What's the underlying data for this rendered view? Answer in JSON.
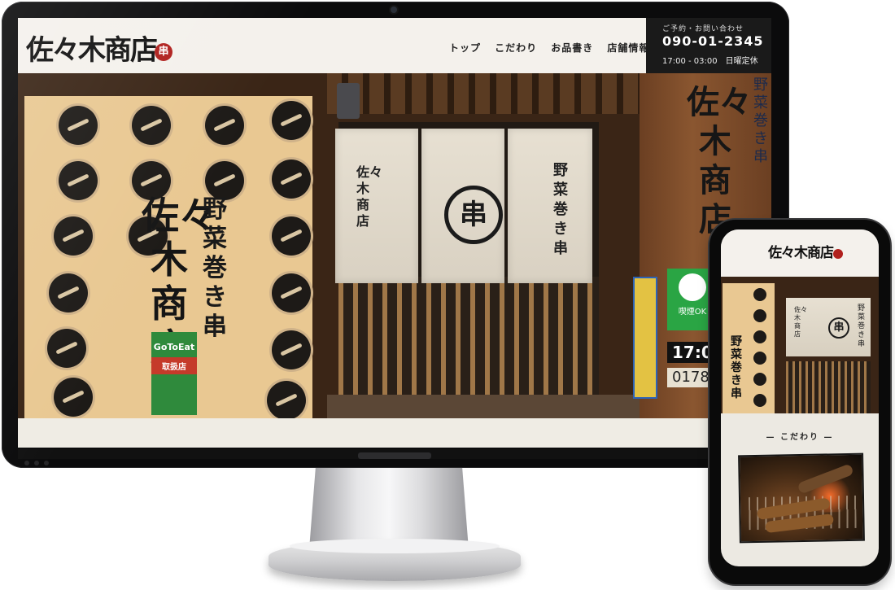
{
  "desktop": {
    "logo": {
      "text": "佐々木商店",
      "seal": "串"
    },
    "nav": [
      "トップ",
      "こだわり",
      "お品書き",
      "店舗情報"
    ],
    "contact": {
      "label": "ご予約・お問い合わせ",
      "phone": "090-01-2345",
      "hours": "17:00 - 03:00　日曜定休"
    },
    "hero": {
      "banner_vertical": "佐々木商店",
      "banner_vertical_small": "野菜巻き串",
      "gotoeat": "GoToEat",
      "gotoeat_sub": "取扱店",
      "noren_left": "佐々木商店",
      "noren_mark": "串",
      "noren_right": "野菜巻き串",
      "sign_right": "佐々木商店",
      "sign_right_small": "野菜巻き串",
      "smoking_sign": "喫煙OK",
      "time_sign": "17:0",
      "number_sign": "0178"
    }
  },
  "mobile": {
    "logo": {
      "text": "佐々木商店"
    },
    "hero": {
      "banner_vertical": "野菜巻き串",
      "noren_left": "佐々木商店",
      "noren_mark": "串",
      "noren_right": "野菜巻き串"
    },
    "section_title": "— こだわり —"
  }
}
